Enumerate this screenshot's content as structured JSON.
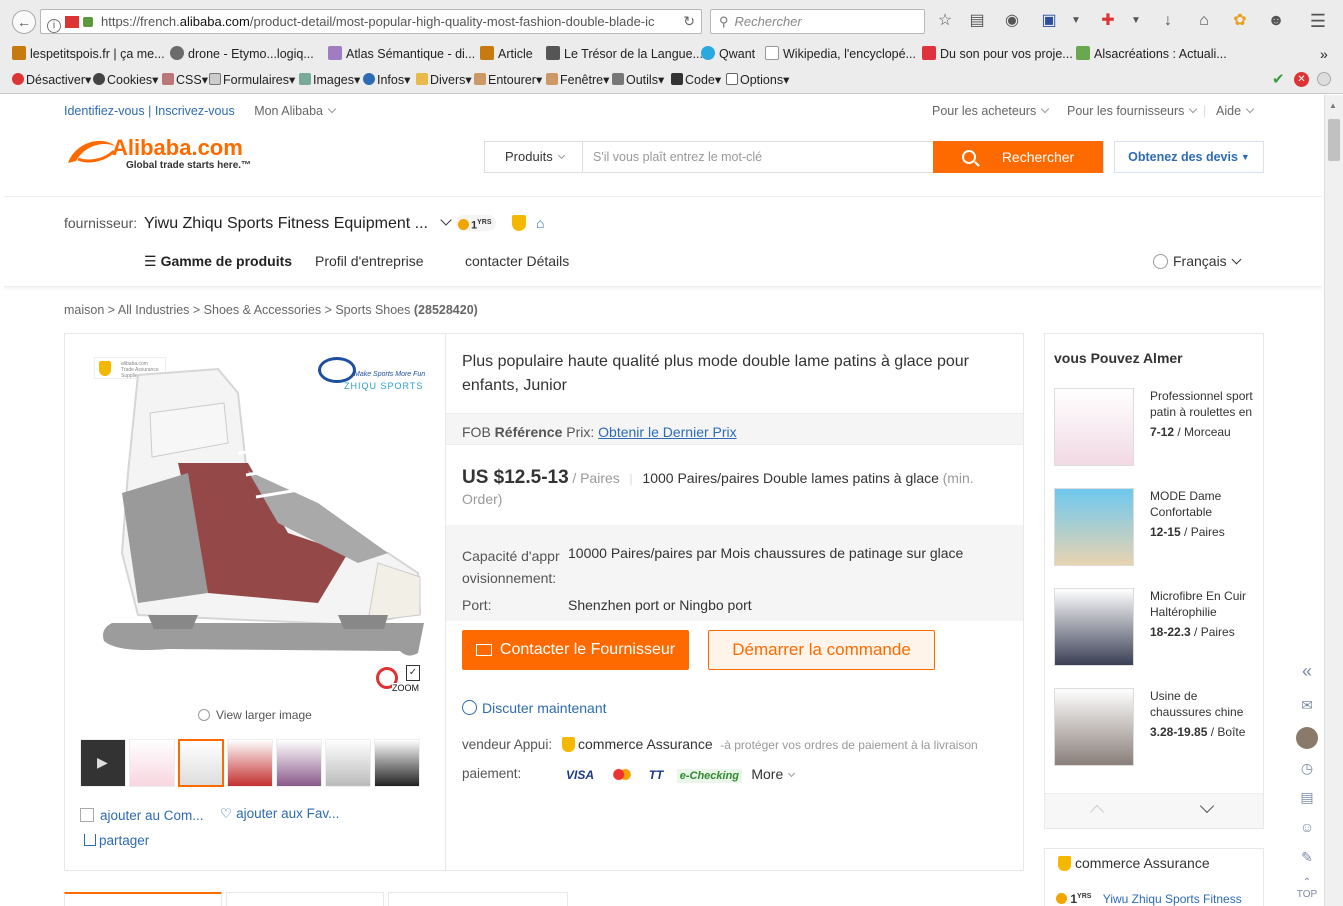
{
  "browser": {
    "url_prefix": "https://french.",
    "url_domain": "alibaba.com",
    "url_rest": "/product-detail/most-popular-high-quality-most-fashion-double-blade-ic",
    "search_placeholder": "Rechercher",
    "bookmarks": [
      {
        "label": "lespetitspois.fr | ça me...",
        "color": "#c77a10"
      },
      {
        "label": "drone - Etymo...logiq...",
        "color": "#6b6b6b"
      },
      {
        "label": "Atlas Sémantique - di...",
        "color": "#a07cc0"
      },
      {
        "label": "Article",
        "color": "#c77a10"
      },
      {
        "label": "Le Trésor de la Langue...",
        "color": "#555555"
      },
      {
        "label": "Qwant",
        "color": "#2aa9e0"
      },
      {
        "label": "Wikipedia, l'encyclopé...",
        "color": "#333333"
      },
      {
        "label": "Du son pour vos proje...",
        "color": "#e0323c"
      },
      {
        "label": "Alsacréations : Actuali...",
        "color": "#6aa84f"
      }
    ],
    "toolbar": [
      "Désactiver",
      "Cookies",
      "CSS",
      "Formulaires",
      "Images",
      "Infos",
      "Divers",
      "Entourer",
      "Fenêtre",
      "Outils",
      "Code",
      "Options"
    ]
  },
  "header": {
    "signin": "Identifiez-vous",
    "register": "Inscrivez-vous",
    "my_alibaba": "Mon Alibaba",
    "buyers": "Pour les acheteurs",
    "suppliers": "Pour les fournisseurs",
    "help": "Aide",
    "logo": "Alibaba.com",
    "tagline": "Global trade starts here.™",
    "search_category": "Produits",
    "search_placeholder": "S'il vous plaît entrez le mot-clé",
    "search_button": "Rechercher",
    "quote_button": "Obtenez des devis"
  },
  "supplier": {
    "label": "fournisseur:",
    "name": "Yiwu Zhiqu Sports Fitness Equipment ...",
    "years": "1",
    "years_unit": "YRS",
    "nav": {
      "products": "Gamme de produits",
      "profile": "Profil d'entreprise",
      "contact": "contacter Détails"
    },
    "language": "Français"
  },
  "breadcrumb": {
    "home": "maison",
    "industries": "All Industries",
    "shoes": "Shoes & Accessories",
    "sports": "Sports Shoes",
    "count": "(28528420)"
  },
  "product": {
    "title": "Plus populaire haute qualité plus mode double lame patins à glace pour enfants, Junior",
    "fob_a": "FOB",
    "fob_b": "Référence",
    "fob_c": "Prix:",
    "fob_link": "Obtenir le Dernier Prix",
    "price": "US $12.5-13",
    "price_unit": "/ Paires",
    "min_order": "1000 Paires/paires Double lames patins à glace",
    "min_order_note_a": "(min.",
    "min_order_note_b": "Order)",
    "capacity_label_a": "Capacité d'appr",
    "capacity_label_b": "ovisionnement:",
    "capacity_value": "10000 Paires/paires par Mois chaussures de patinage sur glace",
    "port_label": "Port:",
    "port_value": "Shenzhen port or Ningbo port",
    "contact_button": "Contacter le Fournisseur",
    "order_button": "Démarrer la commande",
    "chat": "Discuter maintenant",
    "support_label": "vendeur Appui:",
    "support_value": "commerce Assurance",
    "support_note": "-à protéger vos ordres de paiement à la livraison",
    "payment_label": "paiement:",
    "pay_visa": "VISA",
    "pay_tt": "TT",
    "pay_echeck": "e-Checking",
    "pay_more": "More",
    "view_larger": "View larger image",
    "zoom": "ZOOM",
    "compare": "ajouter au Com...",
    "favorite": "ajouter aux Fav...",
    "share": "partager",
    "brand_a": "Make Sports More Fun",
    "brand_b": "ZHIQU SPORTS",
    "ta_badge_a": "alibaba.com",
    "ta_badge_b": "Trade Assurance",
    "ta_badge_c": "Supplier"
  },
  "recommend": {
    "title": "vous Pouvez Almer",
    "items": [
      {
        "title": "Professionnel sport patin à roulettes en",
        "price": "7-12",
        "unit": "/ Morceau"
      },
      {
        "title": "MODE Dame Confortable",
        "price": "12-15",
        "unit": "/ Paires"
      },
      {
        "title": "Microfibre En Cuir Haltérophilie",
        "price": "18-22.3",
        "unit": "/ Paires"
      },
      {
        "title": "Usine de chaussures chine",
        "price": "3.28-19.85",
        "unit": "/ Boîte"
      }
    ],
    "assurance": "commerce Assurance",
    "assurance_years": "1",
    "assurance_years_unit": "YRS",
    "assurance_company": "Yiwu Zhiqu Sports Fitness"
  },
  "side": {
    "top": "TOP"
  }
}
